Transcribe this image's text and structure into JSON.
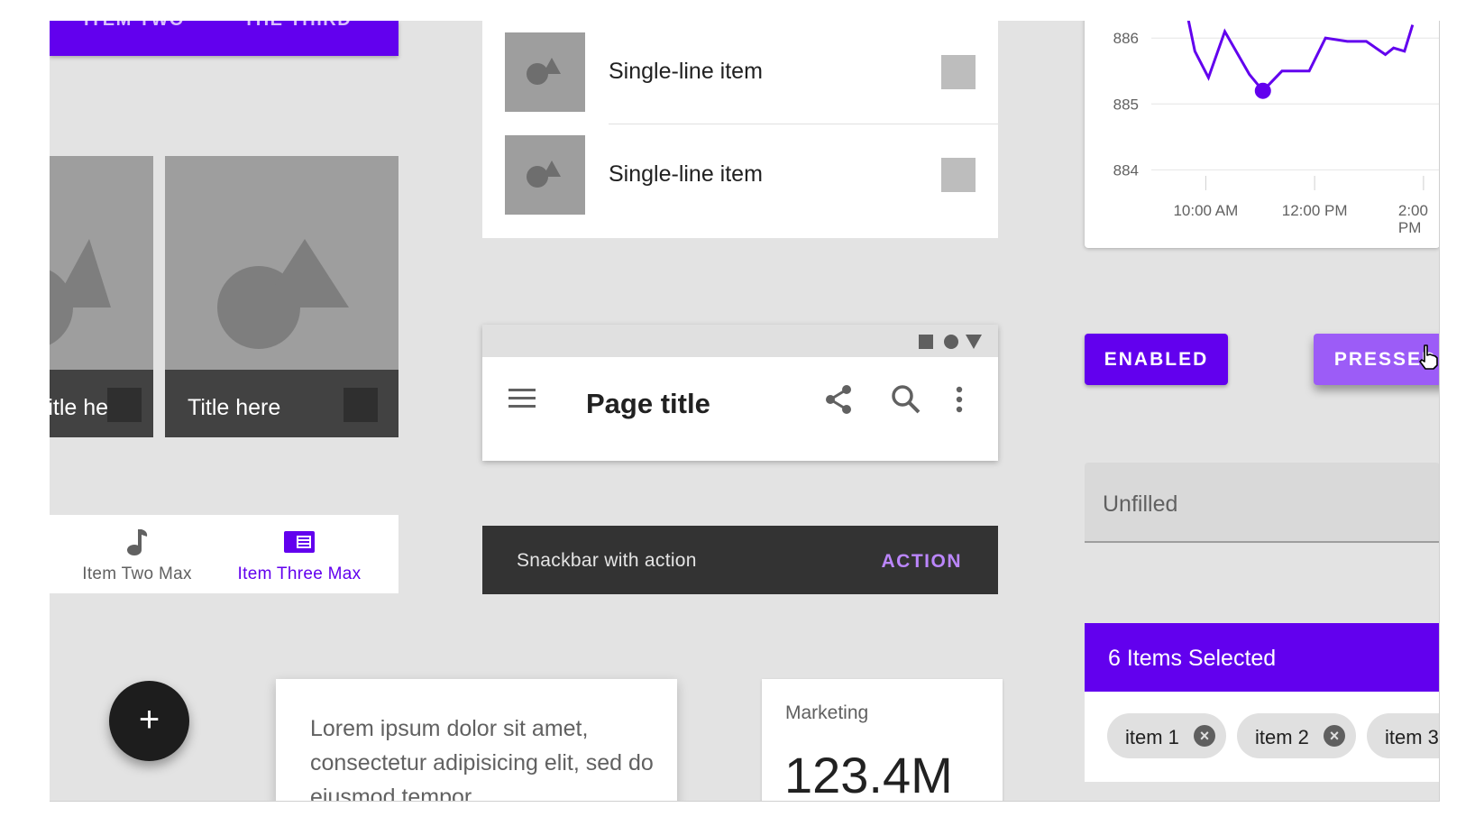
{
  "top_tabs": {
    "items": [
      "ITEM TWO",
      "THE THIRD"
    ]
  },
  "image_cards": [
    {
      "title": "Title here"
    },
    {
      "title": "Title here"
    }
  ],
  "bottom_nav": {
    "items": [
      {
        "label": "Item Two Max",
        "icon": "music-note-icon",
        "active": false
      },
      {
        "label": "Item Three Max",
        "icon": "view-list-icon",
        "active": true
      }
    ],
    "active_color": "#6200ee",
    "inactive_color": "#616161"
  },
  "fab": {
    "icon": "plus-icon",
    "symbol": "+"
  },
  "list": {
    "items": [
      {
        "label": "Single-line item"
      },
      {
        "label": "Single-line item"
      }
    ]
  },
  "app_bar": {
    "title": "Page title",
    "icons": [
      "menu-icon",
      "share-icon",
      "search-icon",
      "more-vert-icon"
    ],
    "status_icons": [
      "square-icon",
      "circle-icon",
      "triangle-icon"
    ]
  },
  "snackbar": {
    "text": "Snackbar with action",
    "action": "ACTION"
  },
  "text_card": {
    "text": "Lorem ipsum dolor sit amet, consectetur adipisicing elit, sed do eiusmod tempor"
  },
  "stat_card": {
    "label": "Marketing",
    "value": "123.4M"
  },
  "chart_data": {
    "type": "line",
    "title": "",
    "xlabel": "",
    "ylabel": "",
    "y_ticks": [
      "886",
      "885",
      "884"
    ],
    "x_ticks": [
      "10:00 AM",
      "12:00 PM",
      "2:00 PM"
    ],
    "ylim": [
      883.8,
      886.4
    ],
    "xlim": [
      9.0,
      14.3
    ],
    "series": [
      {
        "x": [
          9.6,
          9.8,
          10.05,
          10.35,
          10.8,
          11.05,
          11.4,
          11.9,
          12.2,
          12.6,
          12.95,
          13.3,
          13.45,
          13.65,
          13.8
        ],
        "y": [
          886.6,
          885.8,
          885.4,
          886.1,
          885.45,
          885.2,
          885.5,
          885.5,
          886.0,
          885.95,
          885.95,
          885.75,
          885.85,
          885.8,
          886.2
        ],
        "color": "#6200ee"
      }
    ],
    "highlight": {
      "x": 11.05,
      "y": 885.2
    },
    "grid": true
  },
  "buttons": {
    "enabled": "ENABLED",
    "pressed": "PRESSED"
  },
  "text_field": {
    "label": "Unfilled"
  },
  "selection": {
    "title": "6 Items Selected",
    "chips": [
      "item 1",
      "item 2",
      "item 3"
    ]
  },
  "colors": {
    "primary": "#6200ee",
    "primary_pressed": "#9c5cf7",
    "snackbar_action": "#bb86fc"
  }
}
